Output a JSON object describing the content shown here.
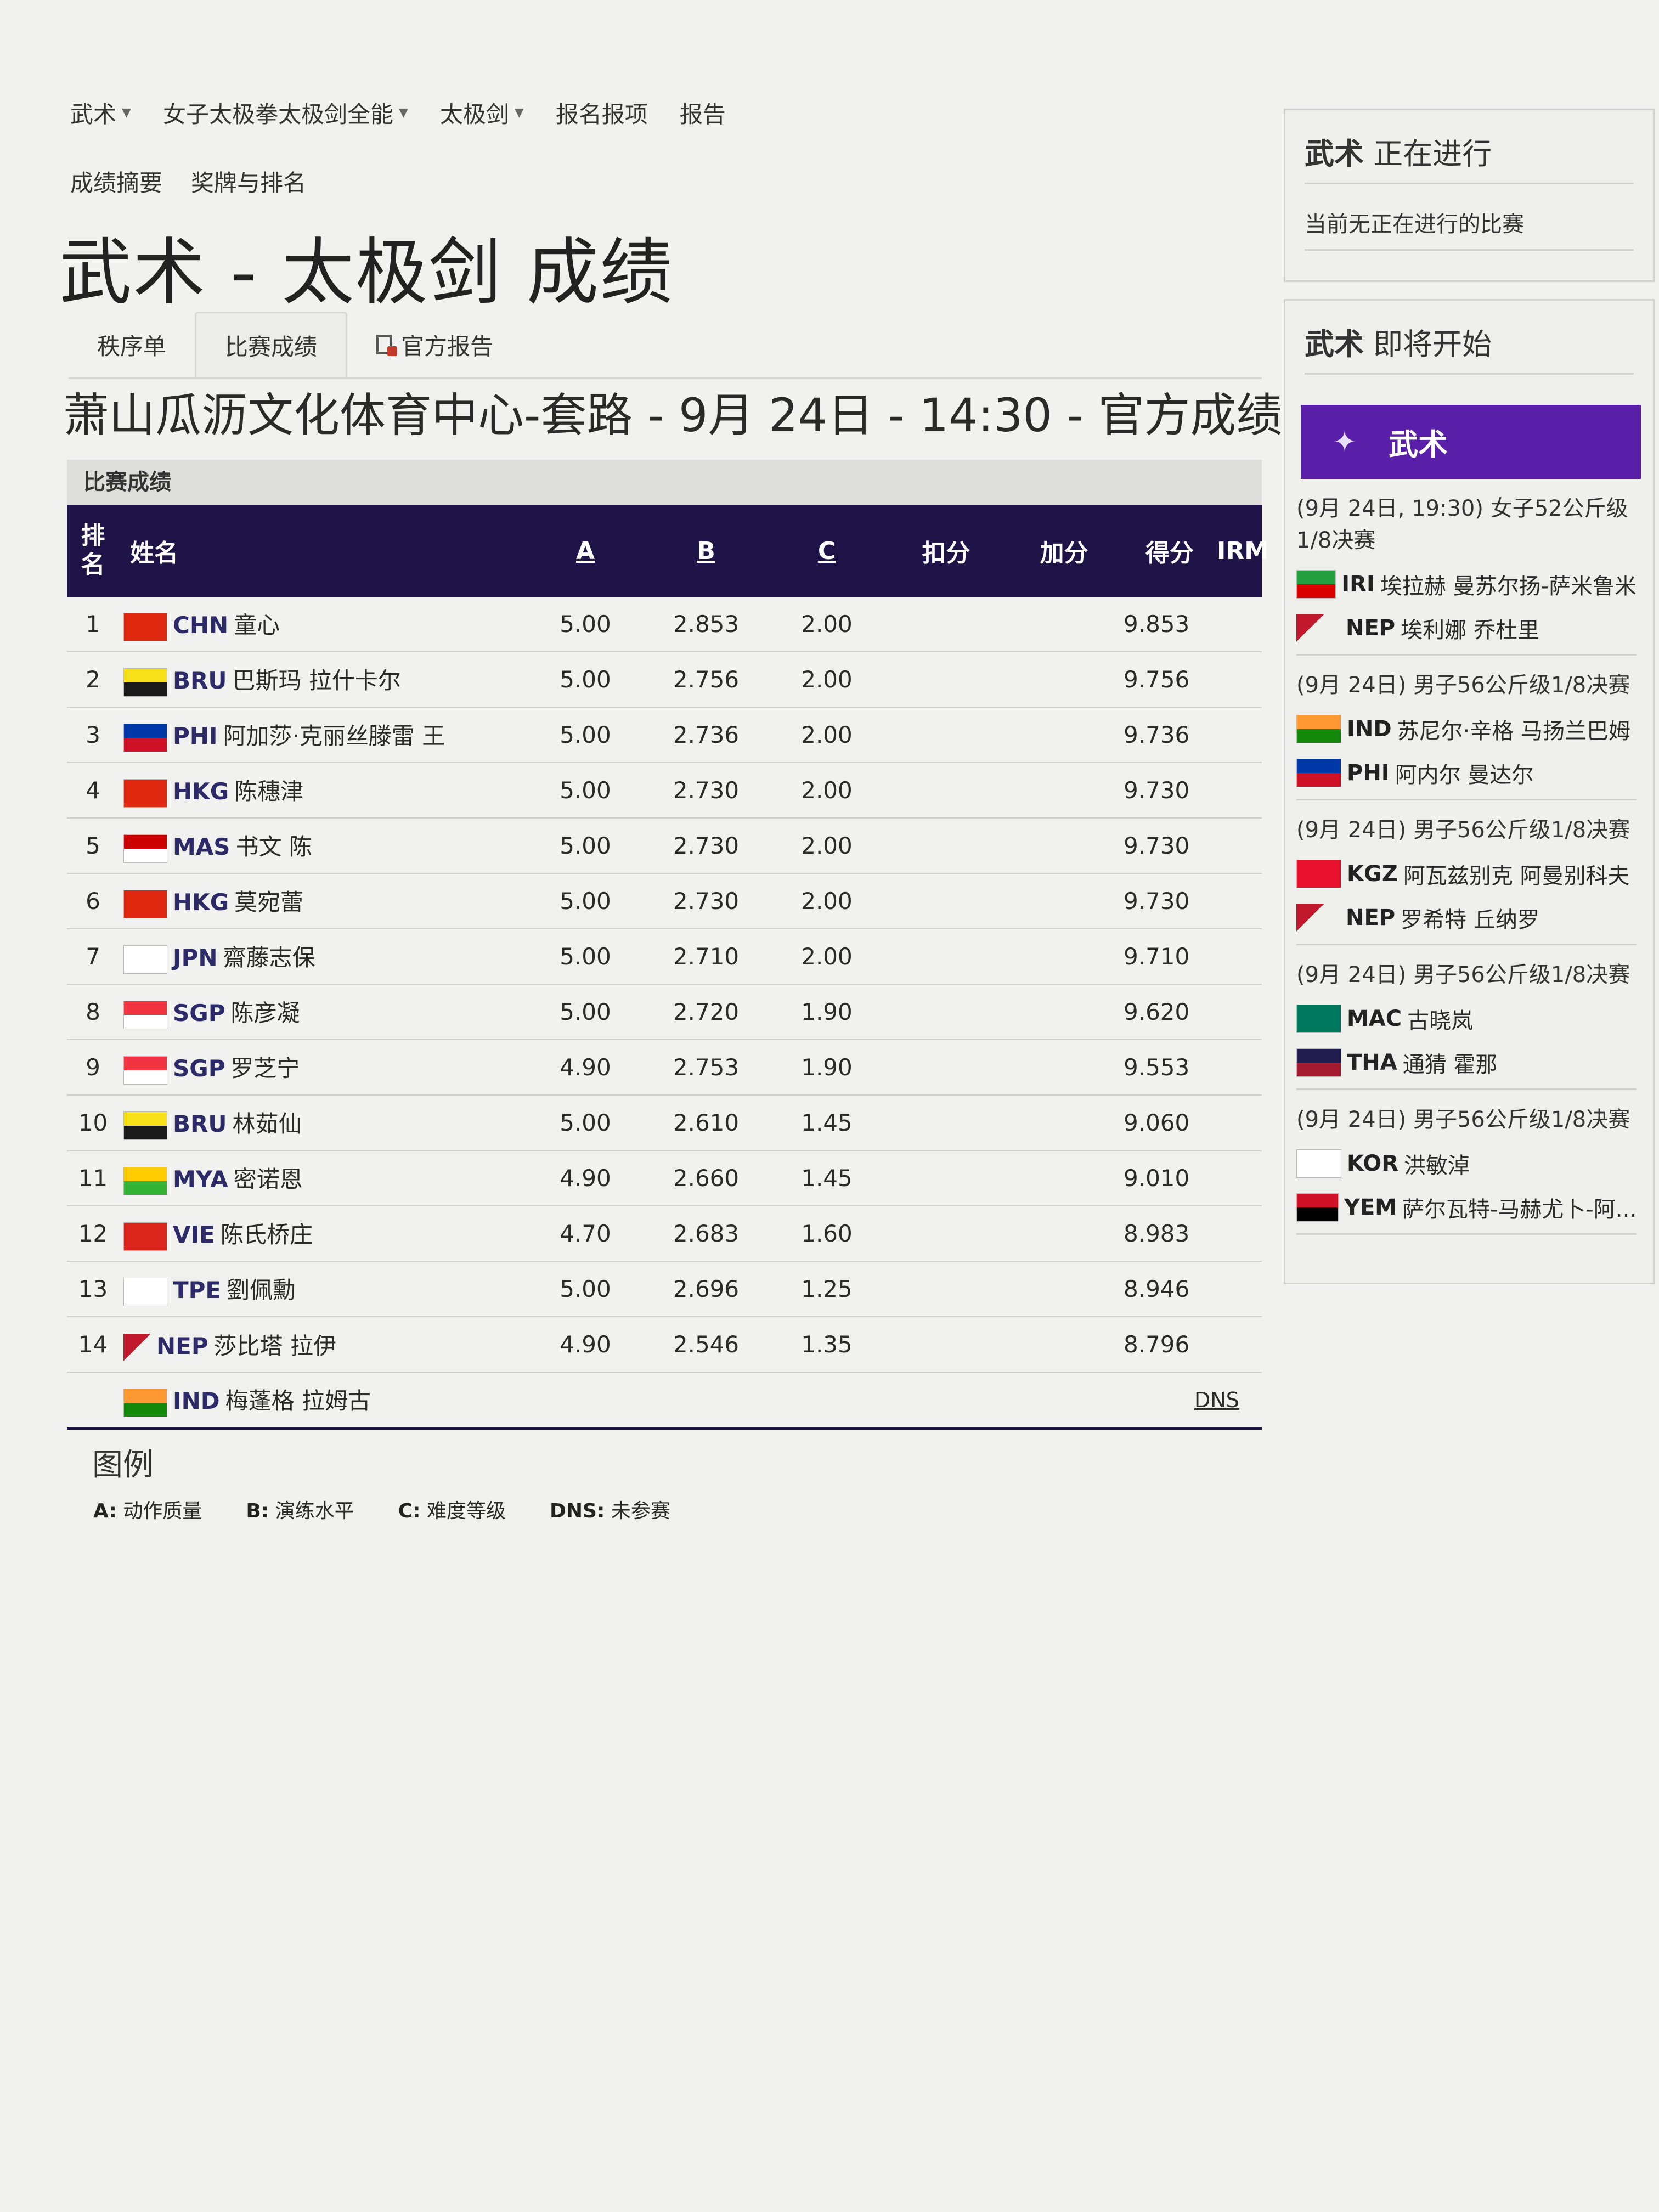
{
  "nav": {
    "items": [
      {
        "label": "武术",
        "dropdown": true
      },
      {
        "label": "女子太极拳太极剑全能",
        "dropdown": true
      },
      {
        "label": "太极剑",
        "dropdown": true
      },
      {
        "label": "报名报项",
        "dropdown": false
      },
      {
        "label": "报告",
        "dropdown": false
      }
    ],
    "sub_items": [
      "成绩摘要",
      "奖牌与排名"
    ]
  },
  "page_title": "武术 - 太极剑 成绩",
  "tabs": {
    "order": "秩序单",
    "results": "比赛成绩",
    "official_report": "官方报告"
  },
  "venue_line": "萧山瓜沥文化体育中心-套路 - 9月 24日 - 14:30 - 官方成绩",
  "results": {
    "section_label": "比赛成绩",
    "columns": {
      "rank": "排名",
      "name": "姓名",
      "a": "A",
      "b": "B",
      "c": "C",
      "deduction": "扣分",
      "bonus": "加分",
      "score": "得分",
      "irm": "IRM"
    },
    "rows": [
      {
        "rank": "1",
        "noc": "CHN",
        "name": "童心",
        "a": "5.00",
        "b": "2.853",
        "c": "2.00",
        "score": "9.853",
        "irm": "",
        "flag": [
          "#de2910",
          "#de2910"
        ]
      },
      {
        "rank": "2",
        "noc": "BRU",
        "name": "巴斯玛 拉什卡尔",
        "a": "5.00",
        "b": "2.756",
        "c": "2.00",
        "score": "9.756",
        "irm": "",
        "flag": [
          "#f7e017",
          "#1a1a1a"
        ]
      },
      {
        "rank": "3",
        "noc": "PHI",
        "name": "阿加莎·克丽丝滕雷 王",
        "a": "5.00",
        "b": "2.736",
        "c": "2.00",
        "score": "9.736",
        "irm": "",
        "flag": [
          "#0038a8",
          "#ce1126"
        ]
      },
      {
        "rank": "4",
        "noc": "HKG",
        "name": "陈穗津",
        "a": "5.00",
        "b": "2.730",
        "c": "2.00",
        "score": "9.730",
        "irm": "",
        "flag": [
          "#de2910",
          "#de2910"
        ]
      },
      {
        "rank": "5",
        "noc": "MAS",
        "name": "书文 陈",
        "a": "5.00",
        "b": "2.730",
        "c": "2.00",
        "score": "9.730",
        "irm": "",
        "flag": [
          "#cc0001",
          "#ffffff"
        ]
      },
      {
        "rank": "6",
        "noc": "HKG",
        "name": "莫宛蕾",
        "a": "5.00",
        "b": "2.730",
        "c": "2.00",
        "score": "9.730",
        "irm": "",
        "flag": [
          "#de2910",
          "#de2910"
        ]
      },
      {
        "rank": "7",
        "noc": "JPN",
        "name": "齋藤志保",
        "a": "5.00",
        "b": "2.710",
        "c": "2.00",
        "score": "9.710",
        "irm": "",
        "flag": [
          "#ffffff",
          "#ffffff"
        ]
      },
      {
        "rank": "8",
        "noc": "SGP",
        "name": "陈彦凝",
        "a": "5.00",
        "b": "2.720",
        "c": "1.90",
        "score": "9.620",
        "irm": "",
        "flag": [
          "#ef3340",
          "#ffffff"
        ]
      },
      {
        "rank": "9",
        "noc": "SGP",
        "name": "罗芝宁",
        "a": "4.90",
        "b": "2.753",
        "c": "1.90",
        "score": "9.553",
        "irm": "",
        "flag": [
          "#ef3340",
          "#ffffff"
        ]
      },
      {
        "rank": "10",
        "noc": "BRU",
        "name": "林茹仙",
        "a": "5.00",
        "b": "2.610",
        "c": "1.45",
        "score": "9.060",
        "irm": "",
        "flag": [
          "#f7e017",
          "#1a1a1a"
        ]
      },
      {
        "rank": "11",
        "noc": "MYA",
        "name": "密诺恩",
        "a": "4.90",
        "b": "2.660",
        "c": "1.45",
        "score": "9.010",
        "irm": "",
        "flag": [
          "#fecb00",
          "#34b233"
        ]
      },
      {
        "rank": "12",
        "noc": "VIE",
        "name": "陈氏桥庄",
        "a": "4.70",
        "b": "2.683",
        "c": "1.60",
        "score": "8.983",
        "irm": "",
        "flag": [
          "#da251d",
          "#da251d"
        ]
      },
      {
        "rank": "13",
        "noc": "TPE",
        "name": "劉佩勳",
        "a": "5.00",
        "b": "2.696",
        "c": "1.25",
        "score": "8.946",
        "irm": "",
        "flag": [
          "#ffffff",
          "#ffffff"
        ]
      },
      {
        "rank": "14",
        "noc": "NEP",
        "name": "莎比塔 拉伊",
        "a": "4.90",
        "b": "2.546",
        "c": "1.35",
        "score": "8.796",
        "irm": "",
        "flag": [
          "#c2182b",
          "#003893"
        ]
      },
      {
        "rank": "",
        "noc": "IND",
        "name": "梅蓬格 拉姆古",
        "a": "",
        "b": "",
        "c": "",
        "score": "",
        "irm": "DNS",
        "flag": [
          "#ff9933",
          "#138808"
        ]
      }
    ]
  },
  "legend": {
    "title": "图例",
    "items": [
      {
        "key": "A:",
        "text": "动作质量"
      },
      {
        "key": "B:",
        "text": "演练水平"
      },
      {
        "key": "C:",
        "text": "难度等级"
      },
      {
        "key": "DNS:",
        "text": "未参赛"
      }
    ]
  },
  "sidebar": {
    "live": {
      "sport": "武术",
      "title": "正在进行",
      "note": "当前无正在进行的比赛"
    },
    "upcoming": {
      "sport": "武术",
      "title": "即将开始",
      "banner": "武术",
      "matches": [
        {
          "head": "(9月 24日, 19:30) 女子52公斤级 1/8决赛",
          "athletes": [
            {
              "noc": "IRI",
              "name": "埃拉赫 曼苏尔扬-萨米鲁米",
              "flag": [
                "#239f40",
                "#da0000"
              ]
            },
            {
              "noc": "NEP",
              "name": "埃利娜 乔杜里",
              "flag": [
                "#c2182b",
                "#003893"
              ]
            }
          ]
        },
        {
          "head": "(9月 24日) 男子56公斤级1/8决赛",
          "athletes": [
            {
              "noc": "IND",
              "name": "苏尼尔·辛格 马扬兰巴姆",
              "flag": [
                "#ff9933",
                "#138808"
              ]
            },
            {
              "noc": "PHI",
              "name": "阿内尔 曼达尔",
              "flag": [
                "#0038a8",
                "#ce1126"
              ]
            }
          ]
        },
        {
          "head": "(9月 24日) 男子56公斤级1/8决赛",
          "athletes": [
            {
              "noc": "KGZ",
              "name": "阿瓦兹别克 阿曼别科夫",
              "flag": [
                "#e8112d",
                "#e8112d"
              ]
            },
            {
              "noc": "NEP",
              "name": "罗希特 丘纳罗",
              "flag": [
                "#c2182b",
                "#003893"
              ]
            }
          ]
        },
        {
          "head": "(9月 24日) 男子56公斤级1/8决赛",
          "athletes": [
            {
              "noc": "MAC",
              "name": "古晓岚",
              "flag": [
                "#00785e",
                "#00785e"
              ]
            },
            {
              "noc": "THA",
              "name": "通猜 霍那",
              "flag": [
                "#241d4f",
                "#a51931"
              ]
            }
          ]
        },
        {
          "head": "(9月 24日) 男子56公斤级1/8决赛",
          "athletes": [
            {
              "noc": "KOR",
              "name": "洪敏淖",
              "flag": [
                "#ffffff",
                "#ffffff"
              ]
            },
            {
              "noc": "YEM",
              "name": "萨尔瓦特-马赫尤卜-阿...",
              "flag": [
                "#ce1126",
                "#000000"
              ]
            }
          ]
        }
      ]
    }
  },
  "colors": {
    "table_header": "#1f1448",
    "sport_banner": "#5a1fa8",
    "noc_text": "#2d2a6a"
  }
}
